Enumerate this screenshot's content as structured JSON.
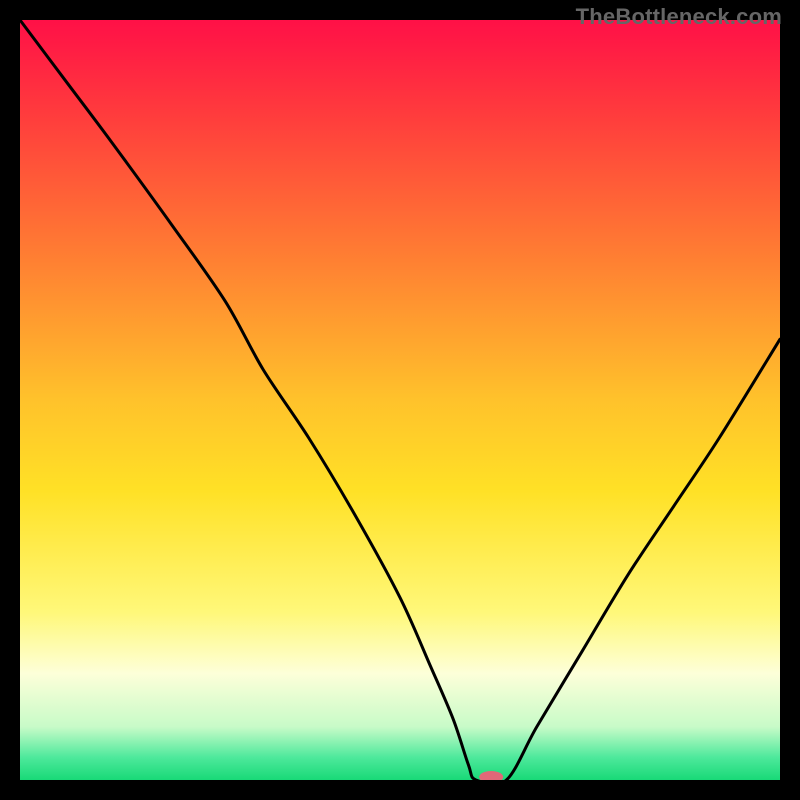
{
  "watermark": "TheBottleneck.com",
  "chart_data": {
    "type": "line",
    "title": "",
    "xlabel": "",
    "ylabel": "",
    "xlim": [
      0,
      100
    ],
    "ylim": [
      0,
      100
    ],
    "grid": false,
    "legend": false,
    "background_gradient": {
      "stops": [
        {
          "pos": 0.0,
          "color": "#ff1047"
        },
        {
          "pos": 0.12,
          "color": "#ff3a3d"
        },
        {
          "pos": 0.3,
          "color": "#ff7a33"
        },
        {
          "pos": 0.5,
          "color": "#ffc22b"
        },
        {
          "pos": 0.62,
          "color": "#ffe126"
        },
        {
          "pos": 0.78,
          "color": "#fff87a"
        },
        {
          "pos": 0.86,
          "color": "#fdffd9"
        },
        {
          "pos": 0.93,
          "color": "#c8fbc8"
        },
        {
          "pos": 0.97,
          "color": "#4ee99c"
        },
        {
          "pos": 1.0,
          "color": "#18d977"
        }
      ]
    },
    "series": [
      {
        "name": "bottleneck-curve",
        "x": [
          0,
          6,
          12,
          20,
          27,
          32,
          38,
          44,
          50,
          54,
          57,
          59,
          60,
          64,
          68,
          74,
          80,
          86,
          92,
          100
        ],
        "y": [
          100,
          92,
          84,
          73,
          63,
          54,
          45,
          35,
          24,
          15,
          8,
          2,
          0,
          0,
          7,
          17,
          27,
          36,
          45,
          58
        ]
      }
    ],
    "marker": {
      "name": "optimal-point",
      "x": 62,
      "y": 0,
      "color": "#e06878",
      "rx": 12,
      "ry": 6
    }
  }
}
